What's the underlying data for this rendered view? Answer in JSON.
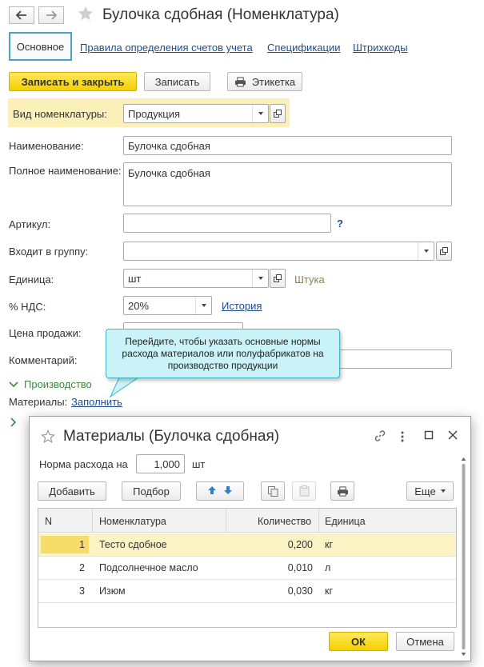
{
  "header": {
    "title": "Булочка сдобная (Номенклатура)",
    "back_icon": "arrow-left-icon",
    "forward_icon": "arrow-right-icon",
    "favorite_icon": "star-icon"
  },
  "tabs": {
    "main": "Основное",
    "links": [
      "Правила определения счетов учета",
      "Спецификации",
      "Штрихкоды"
    ]
  },
  "toolbar": {
    "save_close": "Записать и закрыть",
    "save": "Записать",
    "label_btn": "Этикетка"
  },
  "form": {
    "kind_label": "Вид номенклатуры:",
    "kind_value": "Продукция",
    "name_label": "Наименование:",
    "name_value": "Булочка сдобная",
    "fullname_label": "Полное наименование:",
    "fullname_value": "Булочка сдобная",
    "article_label": "Артикул:",
    "article_value": "",
    "article_help": "?",
    "group_label": "Входит в группу:",
    "group_value": "",
    "unit_label": "Единица:",
    "unit_value": "шт",
    "unit_hint": "Штука",
    "vat_label": "% НДС:",
    "vat_value": "20%",
    "vat_history": "История",
    "price_label": "Цена продажи:",
    "comment_label": "Комментарий:",
    "production_section": "Производство",
    "materials_label": "Материалы:",
    "fill_link": "Заполнить"
  },
  "tooltip": {
    "text": "Перейдите, чтобы указать основные нормы расхода материалов или полуфабрикатов на производство продукции"
  },
  "dialog": {
    "title": "Материалы (Булочка сдобная)",
    "norm_label": "Норма расхода на",
    "norm_value": "1,000",
    "norm_unit": "шт",
    "add_btn": "Добавить",
    "pick_btn": "Подбор",
    "more_btn": "Еще",
    "columns": [
      "N",
      "Номенклатура",
      "Количество",
      "Единица"
    ],
    "rows": [
      {
        "n": "1",
        "name": "Тесто сдобное",
        "qty": "0,200",
        "unit": "кг"
      },
      {
        "n": "2",
        "name": "Подсолнечное масло",
        "qty": "0,010",
        "unit": "л"
      },
      {
        "n": "3",
        "name": "Изюм",
        "qty": "0,030",
        "unit": "кг"
      }
    ],
    "ok_btn": "ОК",
    "cancel_btn": "Отмена"
  },
  "colors": {
    "accent_yellow": "#f4cf00",
    "tab_border": "#4aa3c8",
    "link": "#1c4c91",
    "section_green": "#3c8a3c",
    "tooltip_bg": "#c9f3f8",
    "selected_row": "#fcf3c4"
  }
}
